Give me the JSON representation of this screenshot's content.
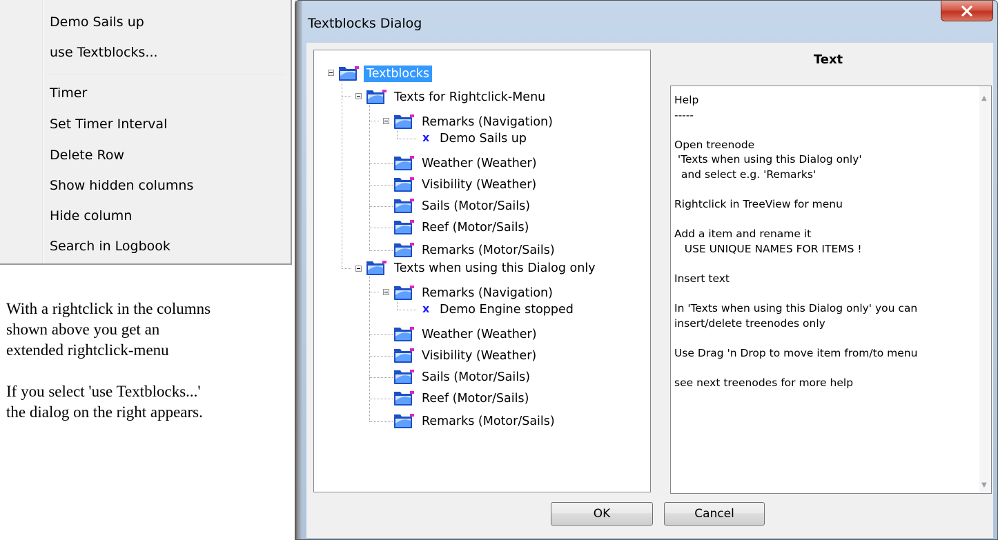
{
  "context_menu": {
    "items_top": [
      "Demo Sails up",
      "use Textblocks..."
    ],
    "items_bottom": [
      "Timer",
      "Set Timer Interval",
      "Delete Row",
      "Show hidden columns",
      "Hide column",
      "Search in Logbook"
    ]
  },
  "description": {
    "lines": [
      "With a rightclick in the columns",
      "shown above you get an",
      "extended rightclick-menu",
      "If you select 'use Textblocks...'",
      "the dialog on the right appears."
    ]
  },
  "dialog": {
    "title": "Textblocks Dialog",
    "close_glyph": "✕",
    "tree": {
      "root": "Textblocks",
      "group1": {
        "label": "Texts for Rightclick-Menu",
        "children": [
          "Remarks (Navigation)",
          "Weather (Weather)",
          "Visibility (Weather)",
          "Sails (Motor/Sails)",
          "Reef (Motor/Sails)",
          "Remarks (Motor/Sails)"
        ],
        "leaf": "Demo Sails up"
      },
      "group2": {
        "label": "Texts when using this Dialog only",
        "children": [
          "Remarks (Navigation)",
          "Weather (Weather)",
          "Visibility (Weather)",
          "Sails (Motor/Sails)",
          "Reef (Motor/Sails)",
          "Remarks (Motor/Sails)"
        ],
        "leaf": "Demo Engine stopped"
      }
    },
    "text_panel": {
      "header": "Text",
      "content": "Help\n-----\n\nOpen treenode\n 'Texts when using this Dialog only'\n  and select e.g. 'Remarks'\n\nRightclick in TreeView for menu\n\nAdd a item and rename it\n   USE UNIQUE NAMES FOR ITEMS !\n\nInsert text\n\nIn 'Texts when using this Dialog only' you can\ninsert/delete treenodes only\n\nUse Drag 'n Drop to move item from/to menu\n\nsee next treenodes for more help"
    },
    "buttons": {
      "ok": "OK",
      "cancel": "Cancel"
    },
    "colors": {
      "selection": "#3399ff",
      "leaf_marker": "#1a1aff",
      "close": "#c2321f"
    }
  }
}
